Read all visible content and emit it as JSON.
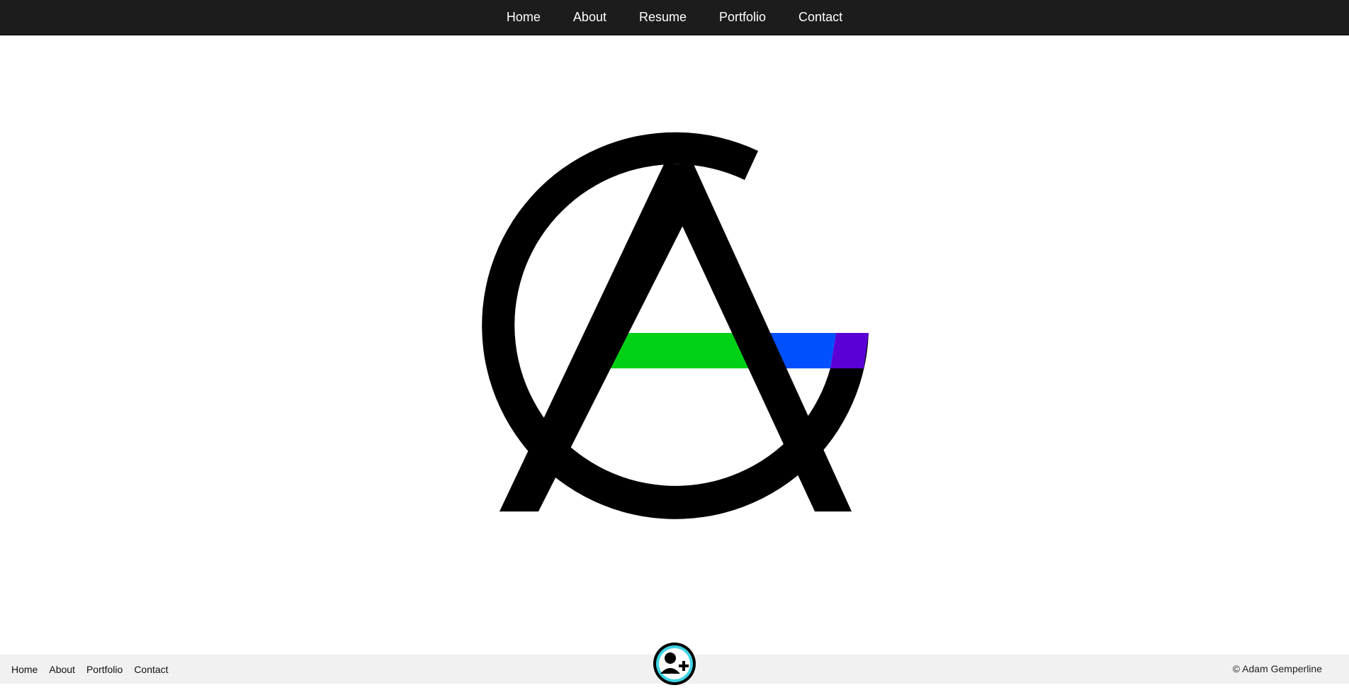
{
  "nav": {
    "items": [
      {
        "label": "Home"
      },
      {
        "label": "About"
      },
      {
        "label": "Resume"
      },
      {
        "label": "Portfolio"
      },
      {
        "label": "Contact"
      }
    ]
  },
  "logo": {
    "icon": "ag-monogram-logo",
    "colors": {
      "letters": "#000000",
      "stripe_green": "#00d116",
      "stripe_blue": "#0050ff",
      "stripe_purple": "#5a00d6"
    }
  },
  "footer": {
    "links": [
      {
        "label": "Home"
      },
      {
        "label": "About"
      },
      {
        "label": "Portfolio"
      },
      {
        "label": "Contact"
      }
    ],
    "copyright": "© Adam Gemperline",
    "contact_icon": "add-contact-icon",
    "badge_color": "#3fd3e6"
  }
}
